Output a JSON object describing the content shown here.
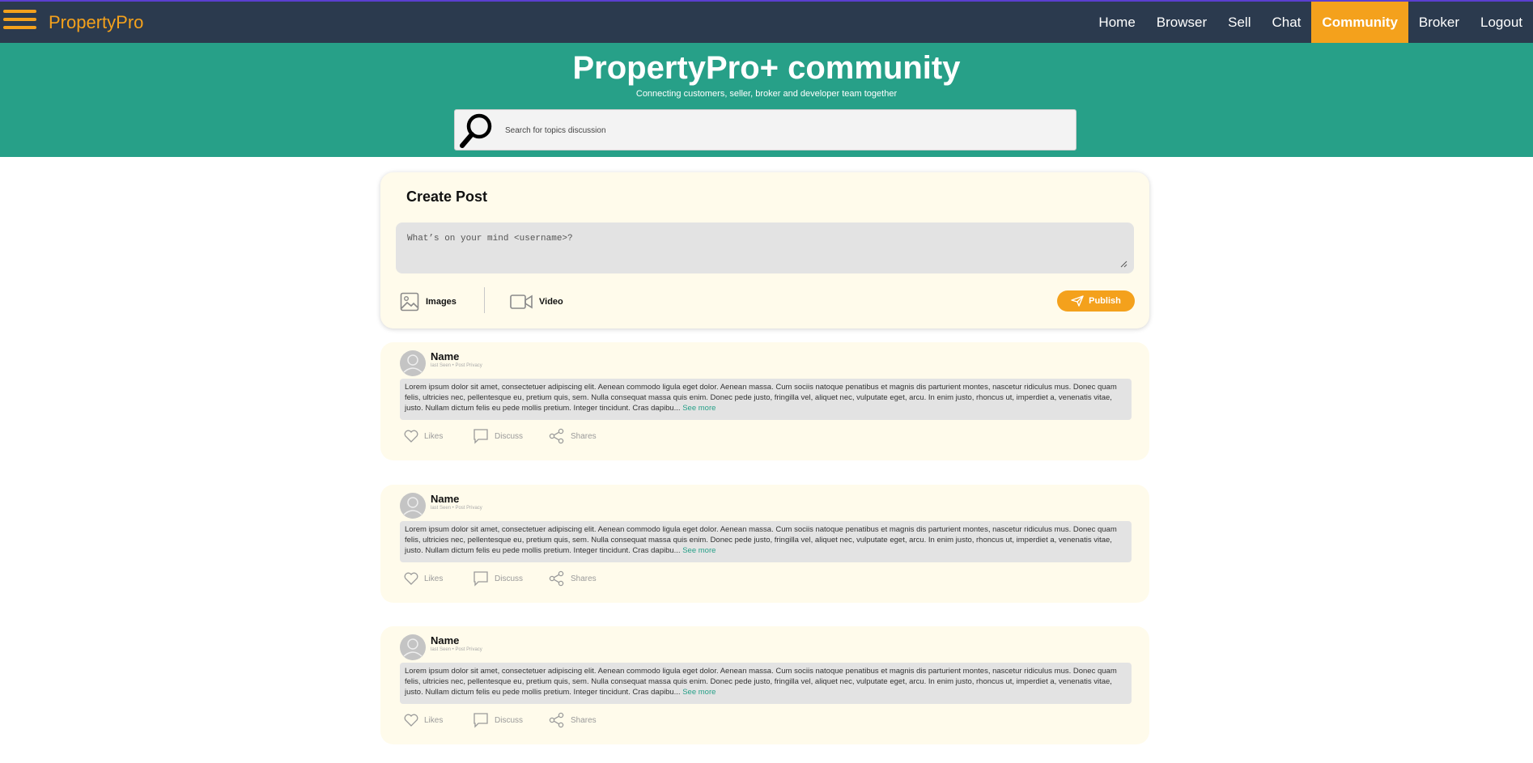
{
  "nav": {
    "brand": "PropertyPro",
    "links": [
      "Home",
      "Browser",
      "Sell",
      "Chat",
      "Community",
      "Broker",
      "Logout"
    ],
    "active": "Community",
    "accent_color": "#f4a11c",
    "bar_color": "#2b3a4e"
  },
  "hero": {
    "title": "PropertyPro+ community",
    "subtitle": "Connecting customers, seller, broker and developer team together",
    "search_placeholder": "Search for topics discussion",
    "bg_color": "#27a088"
  },
  "create_post": {
    "title": "Create Post",
    "placeholder": "What’s on your mind <username>?",
    "images_label": "Images",
    "video_label": "Video",
    "publish_label": "Publish"
  },
  "posts": [
    {
      "name": "Name",
      "meta": "last Seen • Post Privacy",
      "body": "Lorem ipsum dolor sit amet, consectetuer adipiscing elit. Aenean commodo ligula eget dolor. Aenean massa. Cum sociis natoque penatibus et magnis dis parturient montes, nascetur ridiculus mus. Donec quam felis, ultricies nec, pellentesque eu, pretium quis, sem. Nulla consequat massa quis enim. Donec pede justo, fringilla vel, aliquet nec, vulputate eget, arcu. In enim justo, rhoncus ut, imperdiet a, venenatis vitae, justo. Nullam dictum felis eu pede mollis pretium. Integer tincidunt. Cras dapibu...",
      "see_more": "See more",
      "likes": "Likes",
      "discuss": "Discuss",
      "shares": "Shares"
    },
    {
      "name": "Name",
      "meta": "last Seen • Post Privacy",
      "body": "Lorem ipsum dolor sit amet, consectetuer adipiscing elit. Aenean commodo ligula eget dolor. Aenean massa. Cum sociis natoque penatibus et magnis dis parturient montes, nascetur ridiculus mus. Donec quam felis, ultricies nec, pellentesque eu, pretium quis, sem. Nulla consequat massa quis enim. Donec pede justo, fringilla vel, aliquet nec, vulputate eget, arcu. In enim justo, rhoncus ut, imperdiet a, venenatis vitae, justo. Nullam dictum felis eu pede mollis pretium. Integer tincidunt. Cras dapibu...",
      "see_more": "See more",
      "likes": "Likes",
      "discuss": "Discuss",
      "shares": "Shares"
    },
    {
      "name": "Name",
      "meta": "last Seen • Post Privacy",
      "body": "Lorem ipsum dolor sit amet, consectetuer adipiscing elit. Aenean commodo ligula eget dolor. Aenean massa. Cum sociis natoque penatibus et magnis dis parturient montes, nascetur ridiculus mus. Donec quam felis, ultricies nec, pellentesque eu, pretium quis, sem. Nulla consequat massa quis enim. Donec pede justo, fringilla vel, aliquet nec, vulputate eget, arcu. In enim justo, rhoncus ut, imperdiet a, venenatis vitae, justo. Nullam dictum felis eu pede mollis pretium. Integer tincidunt. Cras dapibu...",
      "see_more": "See more",
      "likes": "Likes",
      "discuss": "Discuss",
      "shares": "Shares"
    }
  ],
  "icons": [
    "hamburger-menu-icon",
    "search-icon",
    "image-icon",
    "video-icon",
    "send-icon",
    "avatar-icon",
    "heart-icon",
    "comment-icon",
    "share-icon"
  ]
}
